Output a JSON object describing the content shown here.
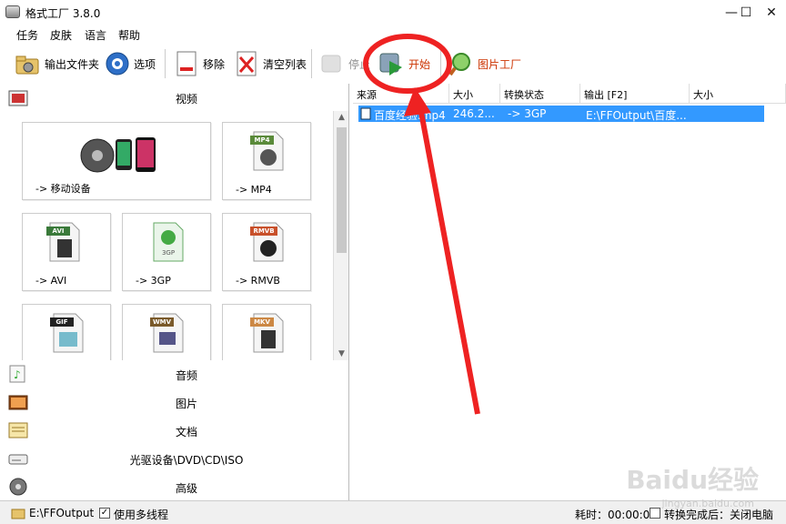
{
  "window": {
    "title": "格式工厂 3.8.0",
    "controls": {
      "minimize": "—",
      "maximize": "☐",
      "close": "✕"
    }
  },
  "menu": [
    "任务",
    "皮肤",
    "语言",
    "帮助"
  ],
  "toolbar": {
    "output_folder": "输出文件夹",
    "options": "选项",
    "remove": "移除",
    "clear_list": "清空列表",
    "stop": "停止",
    "start": "开始",
    "picture_factory": "图片工厂"
  },
  "categories": {
    "video": "视频",
    "audio": "音频",
    "image": "图片",
    "document": "文档",
    "disc": "光驱设备\\DVD\\CD\\ISO",
    "advanced": "高级"
  },
  "video_tiles": [
    {
      "label": "-> 移动设备",
      "badge": ""
    },
    {
      "label": "-> MP4",
      "badge": "MP4"
    },
    {
      "label": "-> AVI",
      "badge": "AVI"
    },
    {
      "label": "-> 3GP",
      "badge": "3GP"
    },
    {
      "label": "-> RMVB",
      "badge": "RMVB"
    },
    {
      "label": "",
      "badge": "GIF"
    },
    {
      "label": "",
      "badge": "WMV"
    },
    {
      "label": "",
      "badge": "MKV"
    }
  ],
  "task_table": {
    "columns": [
      "来源",
      "大小",
      "转换状态",
      "输出 [F2]",
      "大小"
    ],
    "rows": [
      {
        "source": "百度经验.mp4",
        "size": "246.2...",
        "status": "-> 3GP",
        "output": "E:\\FFOutput\\百度..."
      }
    ]
  },
  "statusbar": {
    "output_path": "E:\\FFOutput",
    "multithread": "使用多线程",
    "elapsed": "耗时：00:00:00",
    "after_convert": "转换完成后：关闭电脑"
  },
  "watermark": {
    "text": "Baidu经验",
    "sub": "jingyan.baidu.com"
  },
  "colors": {
    "selection": "#3399ff",
    "annotation": "#ee2222",
    "start_label": "#cc3300"
  }
}
